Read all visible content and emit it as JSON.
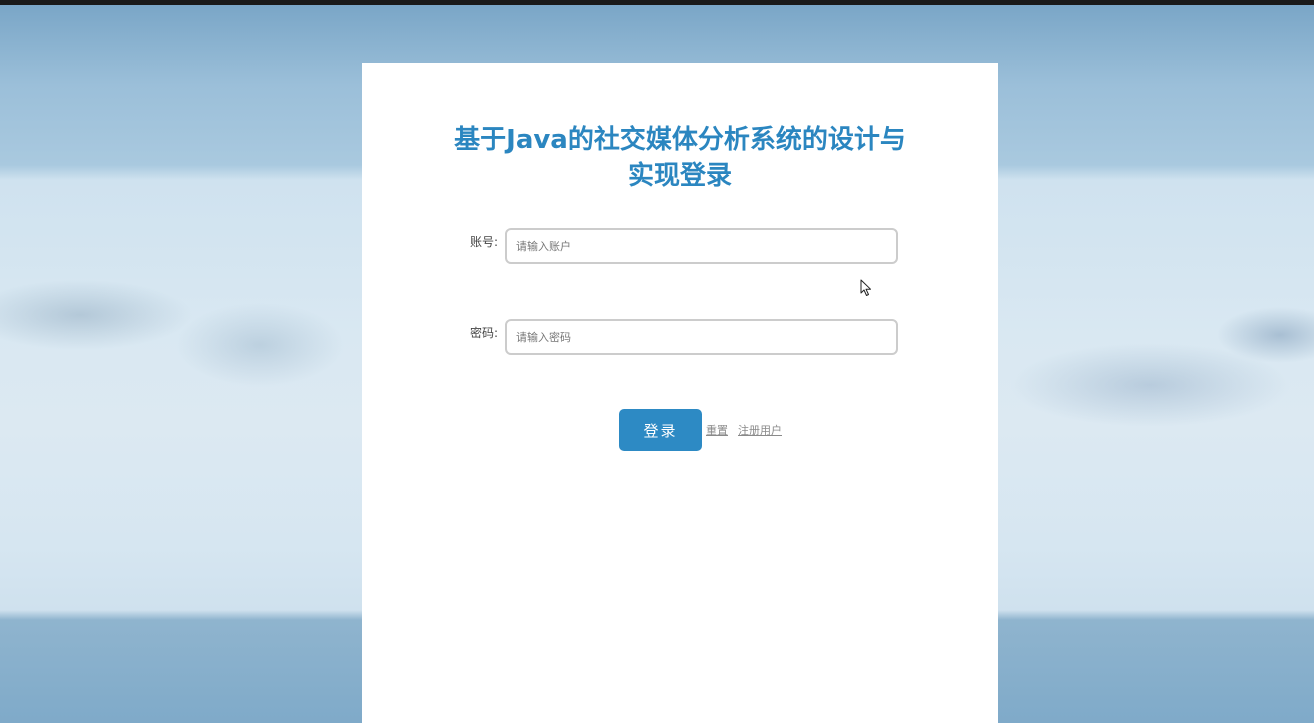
{
  "login": {
    "title": "基于Java的社交媒体分析系统的设计与实现登录",
    "account_label": "账号:",
    "account_placeholder": "请输入账户",
    "password_label": "密码:",
    "password_placeholder": "请输入密码",
    "submit_label": "登录",
    "reset_label": "重置",
    "register_label": "注册用户"
  },
  "colors": {
    "accent": "#2b86c0",
    "button": "#2d8ac4"
  },
  "icons": {
    "cursor": "mouse-pointer-icon"
  }
}
